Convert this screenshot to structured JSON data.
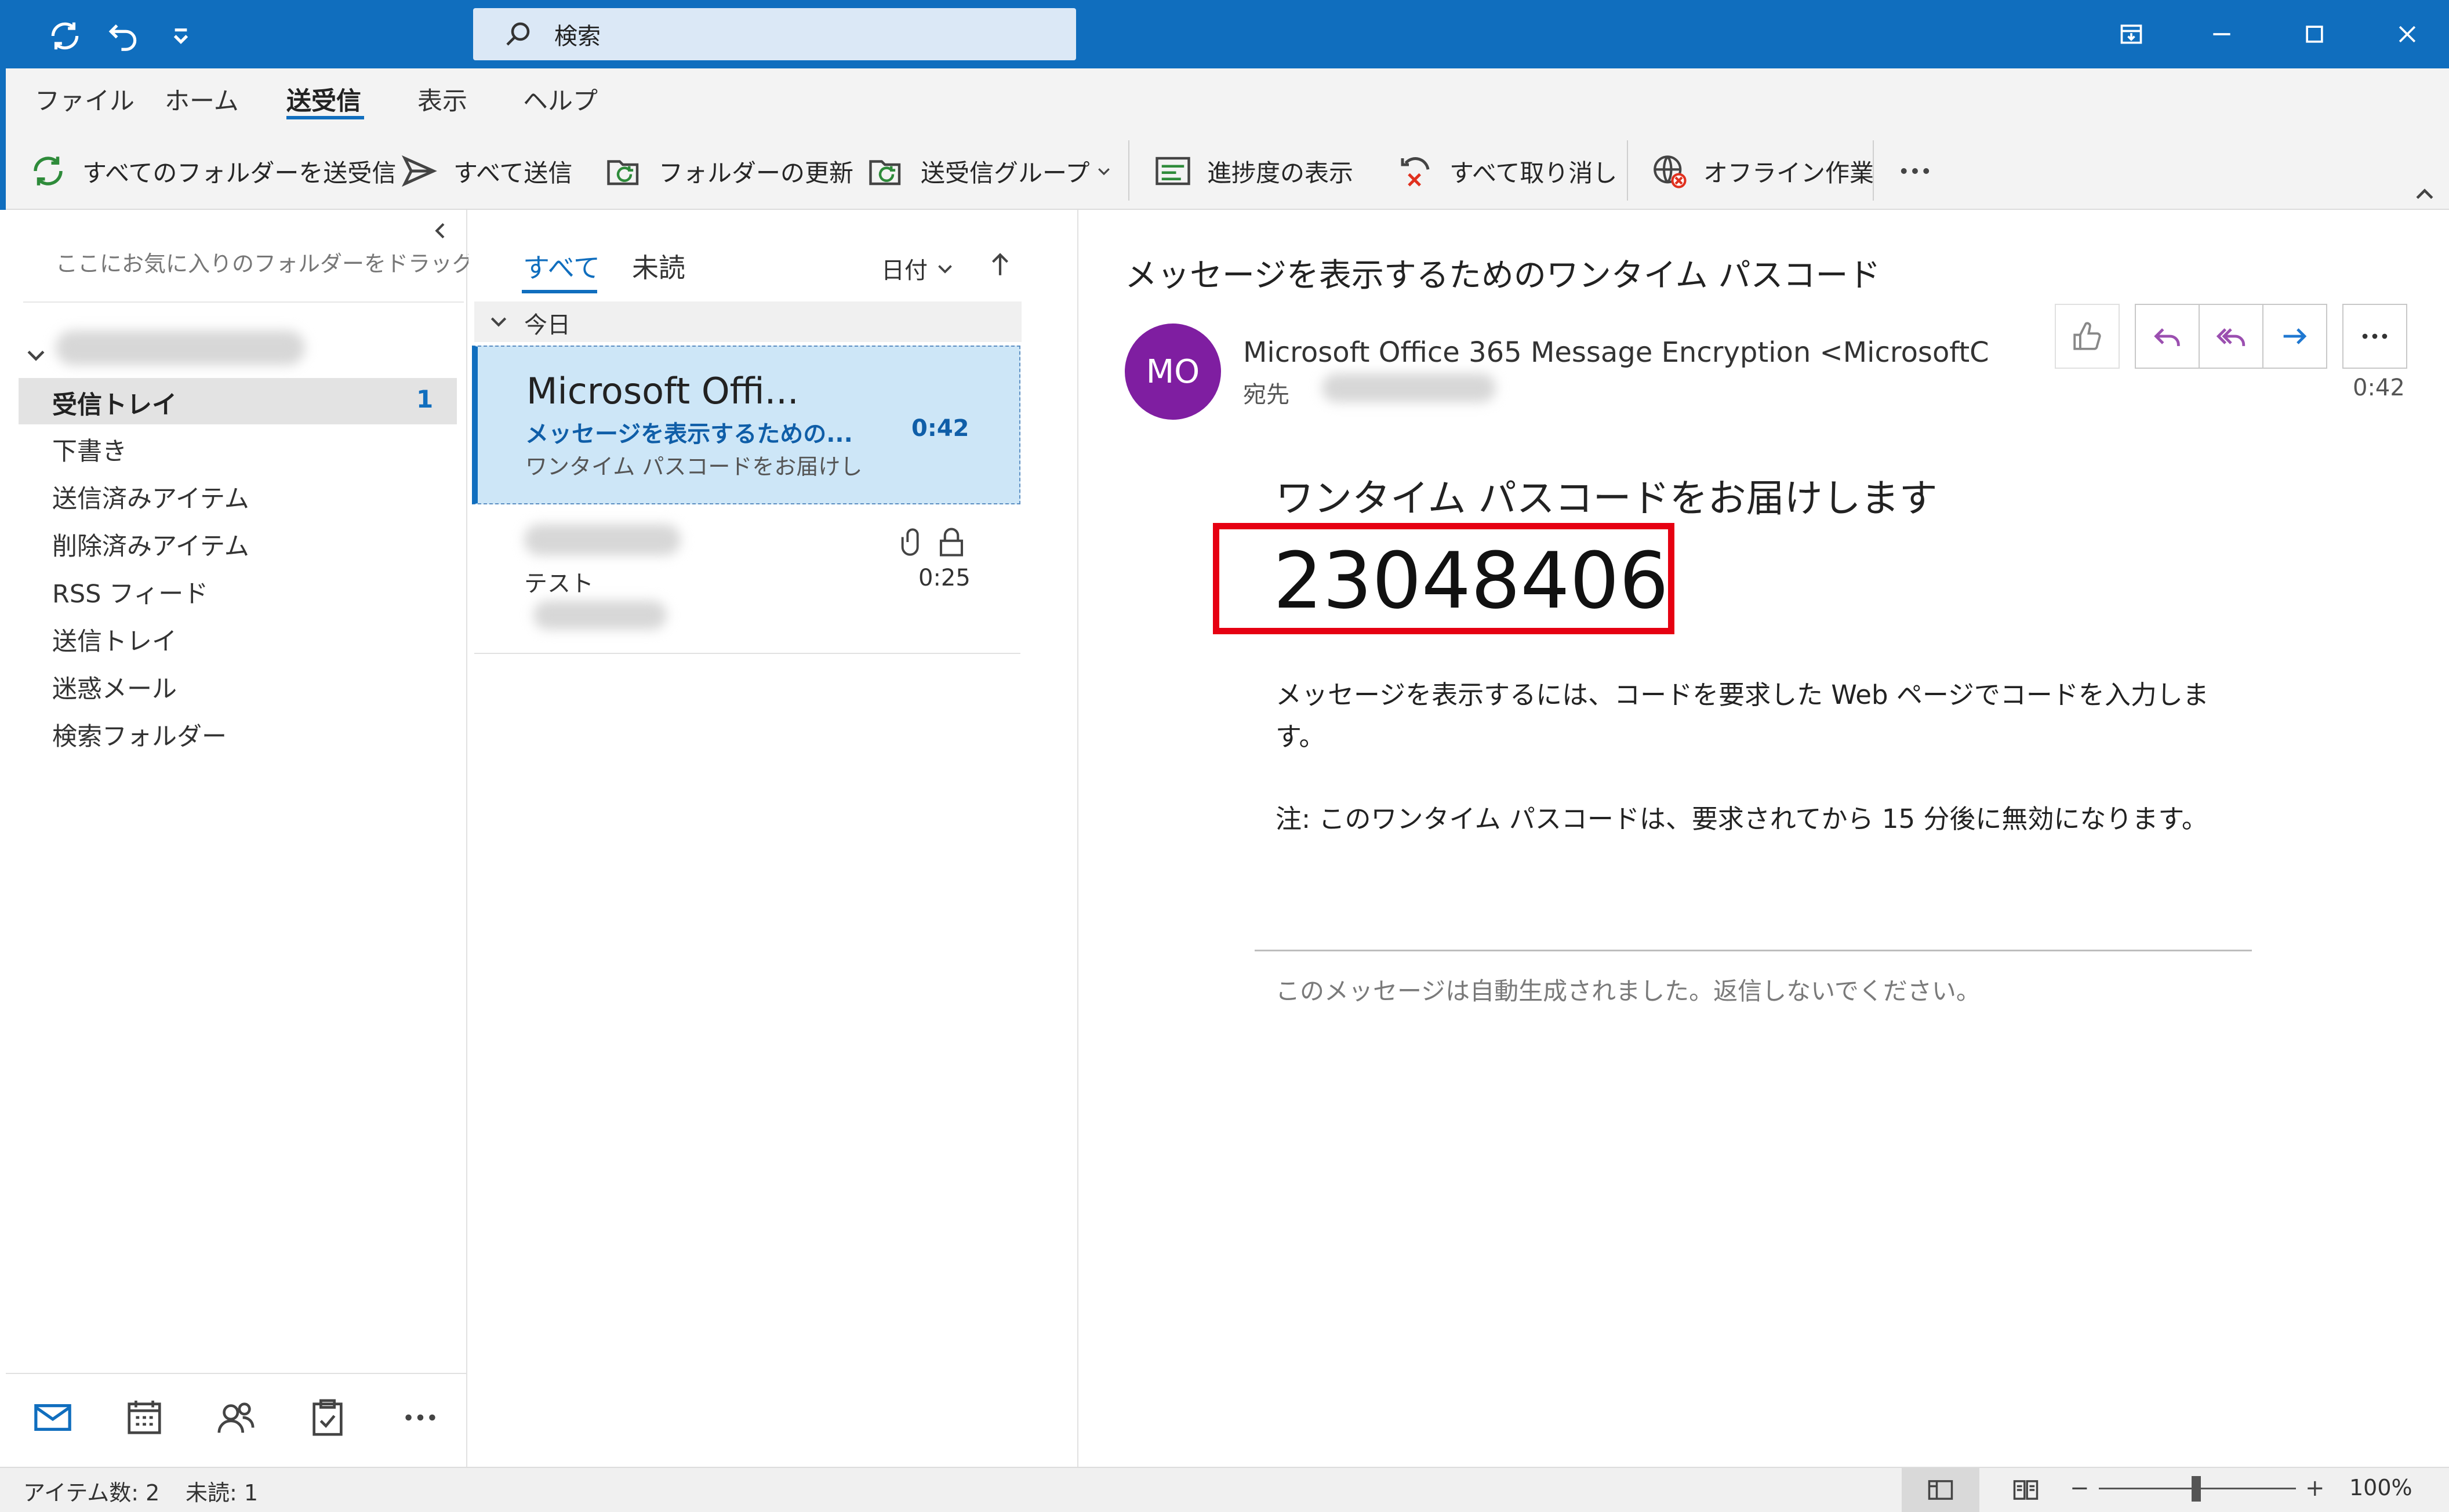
{
  "titlebar": {
    "search_placeholder": "検索"
  },
  "menu": {
    "tabs": [
      "ファイル",
      "ホーム",
      "送受信",
      "表示",
      "ヘルプ"
    ],
    "active_tab": "送受信"
  },
  "ribbon": {
    "send_receive_all": "すべてのフォルダーを送受信",
    "send_all": "すべて送信",
    "update_folder": "フォルダーの更新",
    "send_receive_groups": "送受信グループ",
    "show_progress": "進捗度の表示",
    "cancel_all": "すべて取り消し",
    "work_offline": "オフライン作業"
  },
  "folders": {
    "favorites_hint": "ここにお気に入りのフォルダーをドラッグします",
    "items": [
      {
        "label": "受信トレイ",
        "count": "1"
      },
      {
        "label": "下書き"
      },
      {
        "label": "送信済みアイテム"
      },
      {
        "label": "削除済みアイテム"
      },
      {
        "label": "RSS フィード"
      },
      {
        "label": "送信トレイ"
      },
      {
        "label": "迷惑メール"
      },
      {
        "label": "検索フォルダー"
      }
    ]
  },
  "message_list": {
    "tabs": [
      "すべて",
      "未読"
    ],
    "sort_label": "日付",
    "group_label": "今日",
    "items": [
      {
        "sender": "Microsoft Offi...",
        "subject": "メッセージを表示するための...",
        "time": "0:42",
        "preview": "ワンタイム パスコードをお届けし"
      },
      {
        "subject": "テスト",
        "time": "0:25"
      }
    ]
  },
  "reading_pane": {
    "subject": "メッセージを表示するためのワンタイム パスコード",
    "avatar_initials": "MO",
    "sender": "Microsoft Office 365 Message Encryption <MicrosoftC",
    "to_label": "宛先",
    "time": "0:42",
    "body_heading": "ワンタイム パスコードをお届けします",
    "passcode": "23048406",
    "body_line1": "メッセージを表示するには、コードを要求した Web ページでコードを入力しま",
    "body_line1b": "す。",
    "body_note": "注: このワンタイム パスコードは、要求されてから 15 分後に無効になります。",
    "footer": "このメッセージは自動生成されました。返信しないでください。"
  },
  "status": {
    "items_count": "アイテム数: 2",
    "unread_count": "未読: 1",
    "zoom": "100%",
    "zoom_level_percent": 100
  },
  "colors": {
    "brand": "#106ebe",
    "selected_row": "#cde6f7",
    "avatar": "#7f1ea1",
    "highlight_box": "#e60012",
    "unread_subject": "#0f5ea8"
  }
}
